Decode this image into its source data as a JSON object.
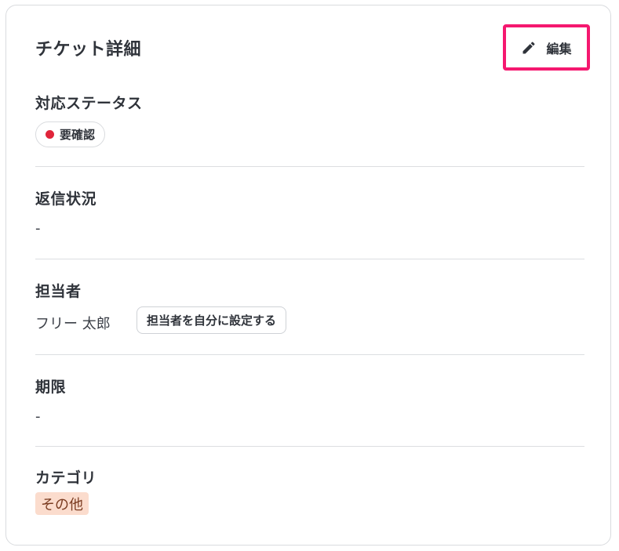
{
  "card": {
    "title": "チケット詳細",
    "edit_label": "編集"
  },
  "sections": {
    "status": {
      "label": "対応ステータス",
      "value": "要確認",
      "dot_color": "#e0243a"
    },
    "reply": {
      "label": "返信状況",
      "value": "-"
    },
    "assignee": {
      "label": "担当者",
      "value": "フリー 太郎",
      "assign_self_label": "担当者を自分に設定する"
    },
    "due": {
      "label": "期限",
      "value": "-"
    },
    "category": {
      "label": "カテゴリ",
      "value": "その他",
      "tag_color": "#fbdccd"
    }
  },
  "colors": {
    "edit_highlight": "#f5186f"
  },
  "icons": {
    "edit": "pencil-icon"
  }
}
